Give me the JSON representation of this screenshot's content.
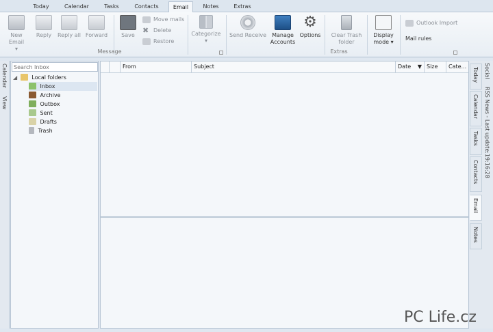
{
  "tabs": [
    "Today",
    "Calendar",
    "Tasks",
    "Contacts",
    "Email",
    "Notes",
    "Extras"
  ],
  "active_tab": "Email",
  "ribbon": {
    "new_email": "New Email",
    "reply": "Reply",
    "reply_all": "Reply all",
    "forward": "Forward",
    "save": "Save",
    "move_mails": "Move mails",
    "delete": "Delete",
    "restore": "Restore",
    "categorize": "Categorize",
    "message_group": "Message",
    "send_receive": "Send Receive",
    "manage_accounts_1": "Manage",
    "manage_accounts_2": "Accounts",
    "options": "Options",
    "clear_trash_1": "Clear Trash",
    "clear_trash_2": "folder",
    "display_mode_1": "Display",
    "display_mode_2": "mode",
    "outlook_import": "Outlook Import",
    "mail_rules": "Mail rules",
    "extras_group": "Extras"
  },
  "left_strip": {
    "calendar": "Calendar",
    "view": "View"
  },
  "folders": {
    "search_placeholder": "Search Inbox",
    "root": "Local folders",
    "items": [
      "Inbox",
      "Archive",
      "Outbox",
      "Sent",
      "Drafts",
      "Trash"
    ],
    "selected": "Inbox"
  },
  "columns": [
    "From",
    "Subject",
    "Date",
    "Size",
    "Cate..."
  ],
  "right_tabs": [
    "Today",
    "Calendar",
    "Tasks",
    "Contacts",
    "Email",
    "Notes"
  ],
  "right_tab_active": "Email",
  "side_panel": {
    "social": "Social",
    "rss": "RSS News - Last update:19:16:28"
  },
  "watermark": "PC Life.cz",
  "colors": {
    "accent": "#3a6ea5",
    "ribbon_bg": "#eef2f6",
    "pane_bg": "#f4f7fa",
    "border": "#b6c4d3",
    "selection": "#dce6f1"
  }
}
